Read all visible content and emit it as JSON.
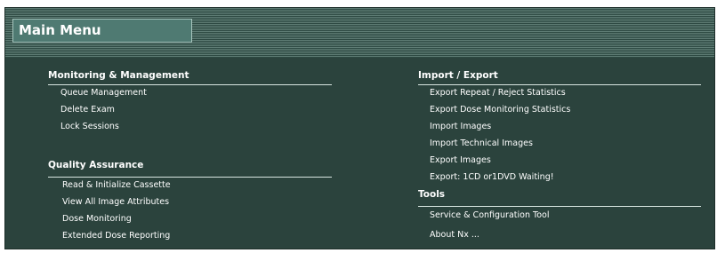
{
  "header": {
    "title": "Main Menu"
  },
  "left": {
    "monitoring": {
      "heading": "Monitoring & Management",
      "items": [
        "Queue Management",
        "Delete Exam",
        "Lock Sessions"
      ]
    },
    "quality": {
      "heading": "Quality Assurance",
      "items": [
        "Read & Initialize Cassette",
        "View All Image Attributes",
        "Dose Monitoring",
        "Extended Dose Reporting"
      ]
    }
  },
  "right": {
    "import_export": {
      "heading": "Import / Export",
      "items": [
        "Export Repeat / Reject Statistics",
        "Export Dose Monitoring Statistics",
        "Import Images",
        "Import Technical Images",
        "Export Images",
        "Export: 1CD or1DVD Waiting!"
      ]
    },
    "tools": {
      "heading": "Tools",
      "items": [
        "Service & Configuration Tool",
        "About Nx ..."
      ]
    }
  },
  "colors": {
    "panel": "#2b433d",
    "title_box": "#4f7a72",
    "text": "#ffffff"
  }
}
